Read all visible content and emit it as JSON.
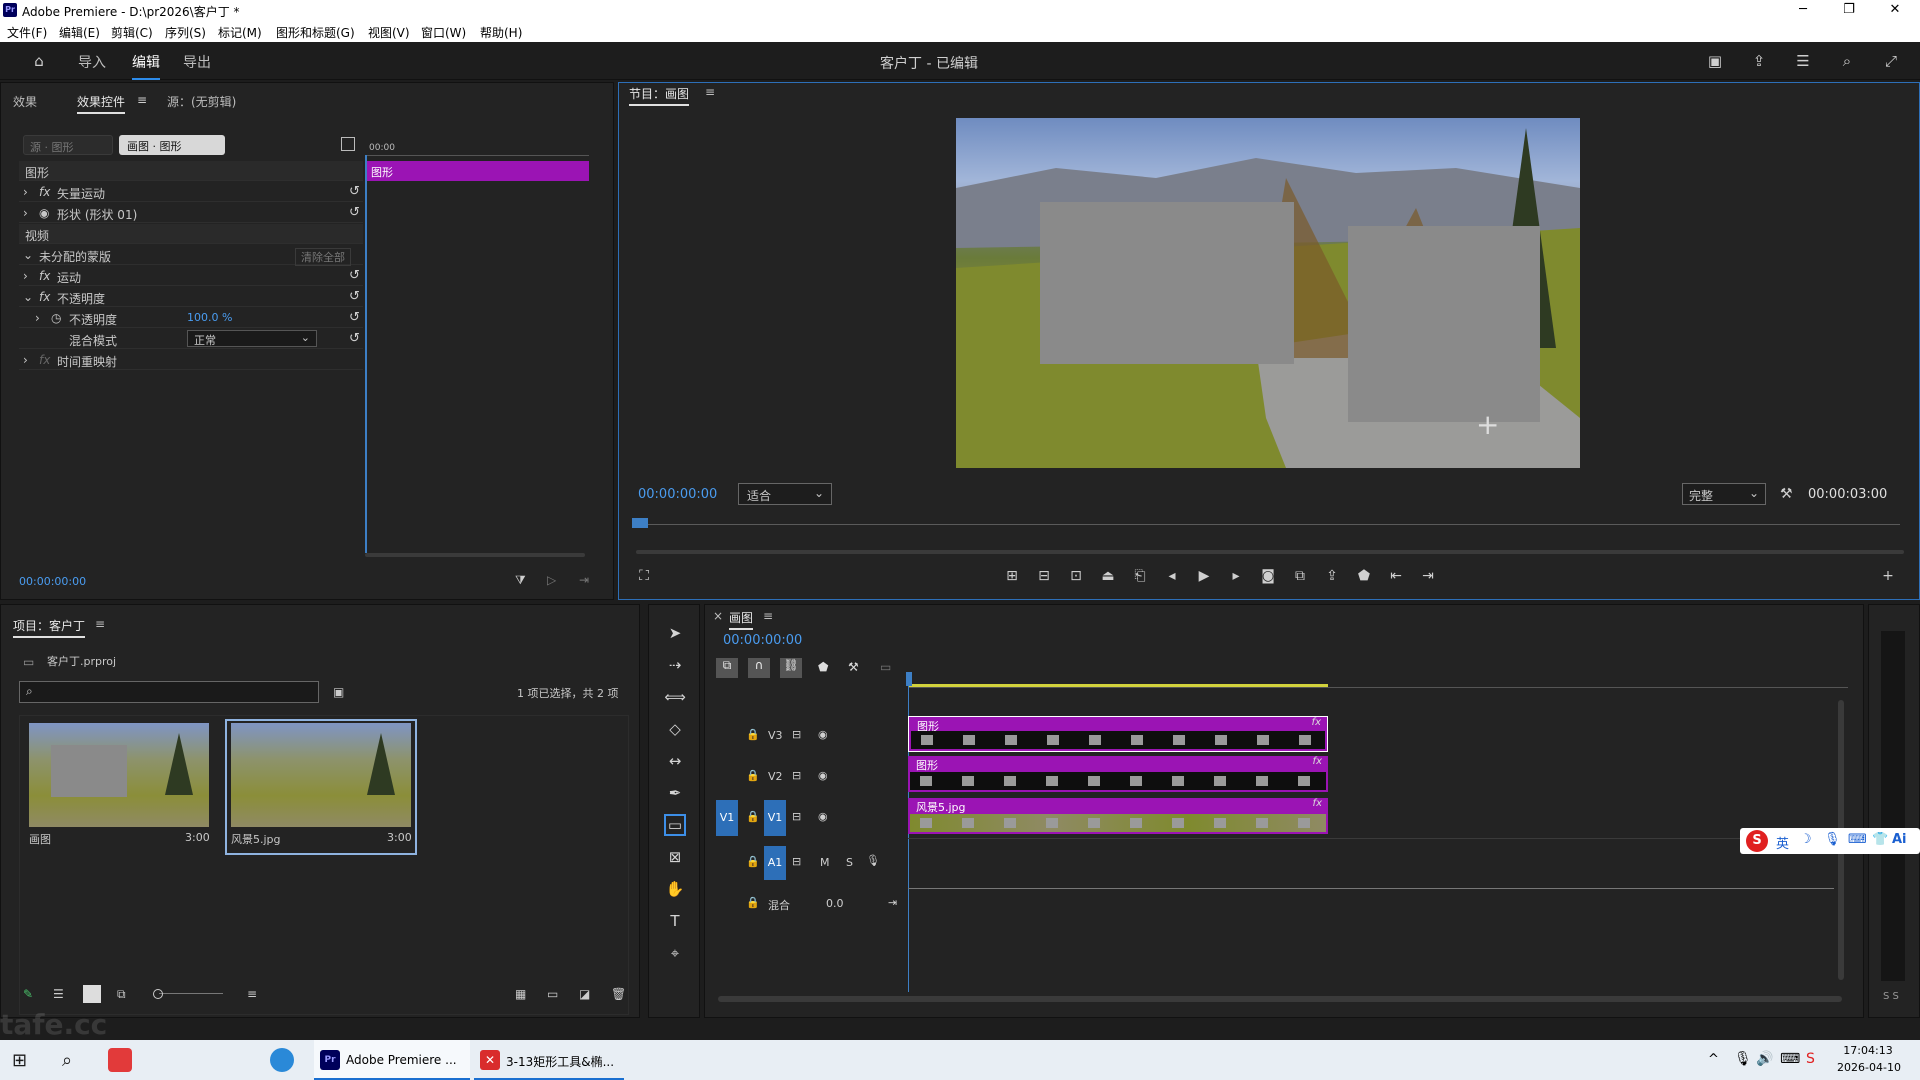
{
  "window": {
    "app_badge": "Pr",
    "title": "Adobe Premiere - D:\\pr2026\\客户丁 *",
    "minimize": "─",
    "maximize": "❐",
    "close": "✕"
  },
  "menu": [
    "文件(F)",
    "编辑(E)",
    "剪辑(C)",
    "序列(S)",
    "标记(M)",
    "图形和标题(G)",
    "视图(V)",
    "窗口(W)",
    "帮助(H)"
  ],
  "header": {
    "workspaces": [
      "导入",
      "编辑",
      "导出"
    ],
    "active_workspace": "编辑",
    "title": "客户丁 - 已编辑"
  },
  "effect_controls": {
    "tabs": [
      "效果",
      "效果控件",
      "源：(无剪辑)"
    ],
    "active_tab": "效果控件",
    "source_btn": "源 · 图形",
    "seq_btn": "画图 · 图形",
    "ruler_time": "00:00",
    "clip_label": "图形",
    "sections": {
      "graphic": "图形",
      "vector_motion": "矢量运动",
      "shape": "形状 (形状 01)",
      "video": "视频",
      "mask": "未分配的蒙版",
      "clear_all": "清除全部",
      "motion": "运动",
      "opacity": "不透明度",
      "opacity_param": "不透明度",
      "opacity_value": "100.0 %",
      "blend_mode": "混合模式",
      "blend_value": "正常",
      "time_remap": "时间重映射"
    },
    "timecode": "00:00:00:00"
  },
  "program": {
    "tab": "节目：画图",
    "timecode": "00:00:00:00",
    "fit": "适合",
    "quality": "完整",
    "duration": "00:00:03:00"
  },
  "project": {
    "tab": "项目：客户丁",
    "file": "客户丁.prproj",
    "search_placeholder": "",
    "selection": "1 项已选择，共 2 项",
    "items": [
      {
        "name": "画图",
        "duration": "3:00"
      },
      {
        "name": "风景5.jpg",
        "duration": "3:00"
      }
    ]
  },
  "timeline": {
    "tab": "画图",
    "timecode": "00:00:00:00",
    "tracks": [
      {
        "id": "V3",
        "clip": "图形"
      },
      {
        "id": "V2",
        "clip": "图形"
      },
      {
        "id": "V1",
        "clip": "风景5.jpg"
      },
      {
        "id": "A1",
        "clip": ""
      }
    ],
    "mix_label": "混合",
    "mix_value": "0.0",
    "audio_m": "M",
    "audio_s": "S",
    "meter_label": "S S"
  },
  "ime": {
    "logo": "S",
    "lang": "英",
    "text": "Ai"
  },
  "taskbar": {
    "apps": [
      "Adobe Premiere ...",
      "3-13矩形工具&椭..."
    ],
    "time": "17:04:13",
    "date": "2026-04-10",
    "watermark": "tafe.cc"
  }
}
